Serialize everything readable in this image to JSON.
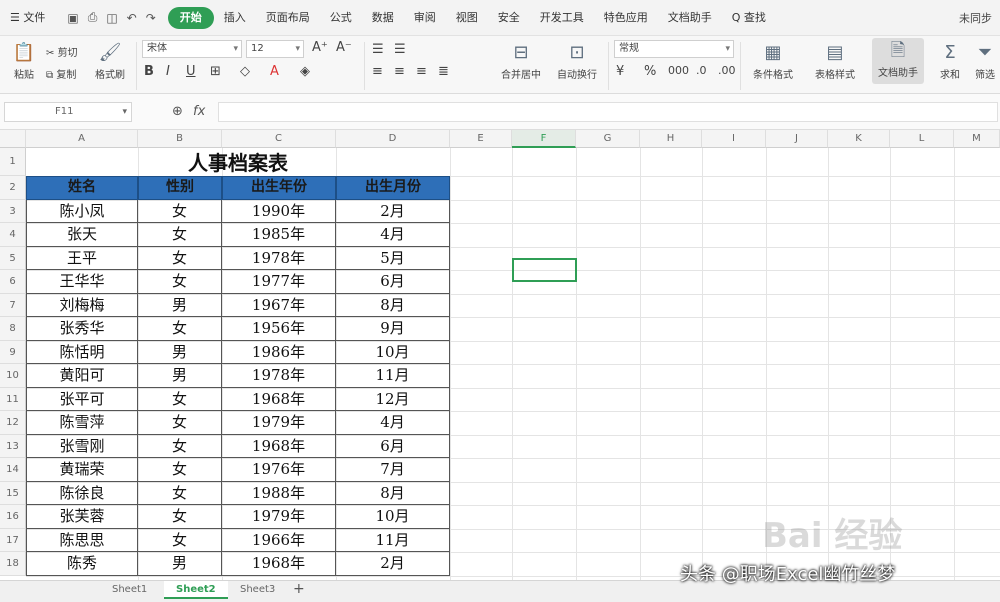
{
  "menubar": {
    "file_label": "文件",
    "tabs": [
      "开始",
      "插入",
      "页面布局",
      "公式",
      "数据",
      "审阅",
      "视图",
      "安全",
      "开发工具",
      "特色应用",
      "文档助手"
    ],
    "active_tab": "开始",
    "search_label": "Q 查找",
    "right_label": "未同步"
  },
  "ribbon": {
    "cut": "剪切",
    "paste": "粘贴",
    "copy": "复制",
    "format_painter": "格式刷",
    "font_name": "宋体",
    "font_size": "12",
    "merge_center": "合并居中",
    "wrap_text": "自动换行",
    "number_format": "常规",
    "cond_format": "条件格式",
    "table_style": "表格样式",
    "doc_helper": "文档助手",
    "sum": "求和",
    "filter": "筛选"
  },
  "formula_bar": {
    "name_box": "F11",
    "fx": "fx",
    "value": ""
  },
  "grid": {
    "columns": [
      "A",
      "B",
      "C",
      "D",
      "E",
      "F",
      "G",
      "H",
      "I",
      "J",
      "K",
      "L",
      "M"
    ],
    "rows": [
      "1",
      "2",
      "3",
      "4",
      "5",
      "6",
      "7",
      "8",
      "9",
      "10",
      "11",
      "12",
      "13",
      "14",
      "15",
      "16",
      "17",
      "18"
    ],
    "selected_cell": "F11"
  },
  "table": {
    "title": "人事档案表",
    "headers": [
      "姓名",
      "性别",
      "出生年份",
      "出生月份"
    ],
    "rows": [
      [
        "陈小凤",
        "女",
        "1990年",
        "2月"
      ],
      [
        "张天",
        "女",
        "1985年",
        "4月"
      ],
      [
        "王平",
        "女",
        "1978年",
        "5月"
      ],
      [
        "王华华",
        "女",
        "1977年",
        "6月"
      ],
      [
        "刘梅梅",
        "男",
        "1967年",
        "8月"
      ],
      [
        "张秀华",
        "女",
        "1956年",
        "9月"
      ],
      [
        "陈恬明",
        "男",
        "1986年",
        "10月"
      ],
      [
        "黄阳可",
        "男",
        "1978年",
        "11月"
      ],
      [
        "张平可",
        "女",
        "1968年",
        "12月"
      ],
      [
        "陈雪萍",
        "女",
        "1979年",
        "4月"
      ],
      [
        "张雪刚",
        "女",
        "1968年",
        "6月"
      ],
      [
        "黄瑞荣",
        "女",
        "1976年",
        "7月"
      ],
      [
        "陈徐良",
        "女",
        "1988年",
        "8月"
      ],
      [
        "张芙蓉",
        "女",
        "1979年",
        "10月"
      ],
      [
        "陈思思",
        "女",
        "1966年",
        "11月"
      ],
      [
        "陈秀",
        "男",
        "1968年",
        "2月"
      ]
    ]
  },
  "sheets": {
    "tabs": [
      "Sheet1",
      "Sheet2",
      "Sheet3"
    ],
    "active": "Sheet2",
    "add": "+"
  },
  "watermarks": {
    "baidu": "Bai 经验",
    "author": "头条 @职场Excel幽竹丝梦"
  },
  "colors": {
    "accent": "#2f9e55",
    "header_fill": "#2e6fb8"
  }
}
